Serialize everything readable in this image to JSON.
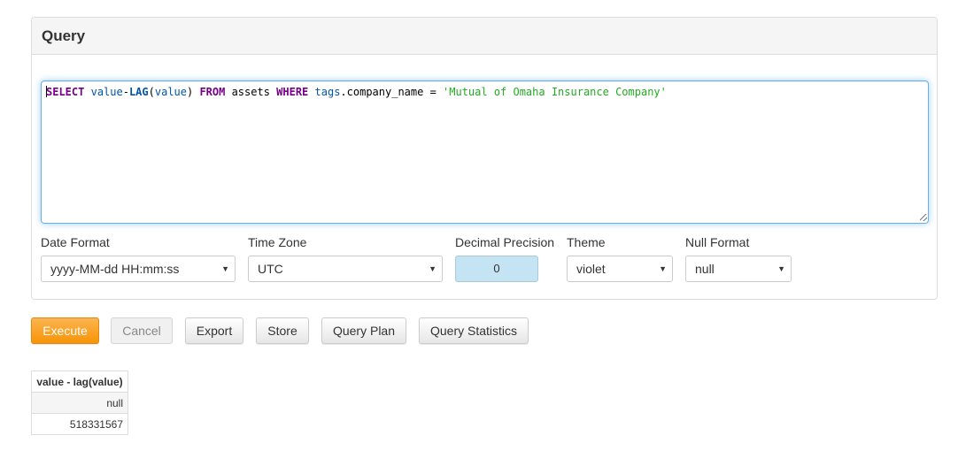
{
  "panel": {
    "title": "Query"
  },
  "query": {
    "tokens": [
      {
        "text": "SELECT",
        "kind": "kw"
      },
      {
        "text": " ",
        "kind": "plain"
      },
      {
        "text": "value",
        "kind": "var"
      },
      {
        "text": "-",
        "kind": "plain"
      },
      {
        "text": "LAG",
        "kind": "fn"
      },
      {
        "text": "(",
        "kind": "plain"
      },
      {
        "text": "value",
        "kind": "var"
      },
      {
        "text": ") ",
        "kind": "plain"
      },
      {
        "text": "FROM",
        "kind": "kw"
      },
      {
        "text": " assets ",
        "kind": "plain"
      },
      {
        "text": "WHERE",
        "kind": "kw"
      },
      {
        "text": " ",
        "kind": "plain"
      },
      {
        "text": "tags",
        "kind": "var"
      },
      {
        "text": ".company_name = ",
        "kind": "plain"
      },
      {
        "text": "'Mutual of Omaha Insurance Company'",
        "kind": "str"
      }
    ]
  },
  "options": {
    "date_format": {
      "label": "Date Format",
      "value": "yyyy-MM-dd HH:mm:ss"
    },
    "time_zone": {
      "label": "Time Zone",
      "value": "UTC"
    },
    "decimal_precision": {
      "label": "Decimal Precision",
      "value": "0"
    },
    "theme": {
      "label": "Theme",
      "value": "violet"
    },
    "null_format": {
      "label": "Null Format",
      "value": "null"
    }
  },
  "buttons": {
    "execute": "Execute",
    "cancel": "Cancel",
    "export": "Export",
    "store": "Store",
    "query_plan": "Query Plan",
    "query_statistics": "Query Statistics"
  },
  "results": {
    "columns": [
      "value - lag(value)"
    ],
    "rows": [
      [
        "null"
      ],
      [
        "518331567"
      ]
    ]
  },
  "colors": {
    "execute_button": "#f89406",
    "keyword": "#770088",
    "string": "#22aa22",
    "variable": "#0055aa"
  },
  "icons": {
    "select_caret": "chevron-down-icon",
    "resize": "resize-grip-icon"
  }
}
